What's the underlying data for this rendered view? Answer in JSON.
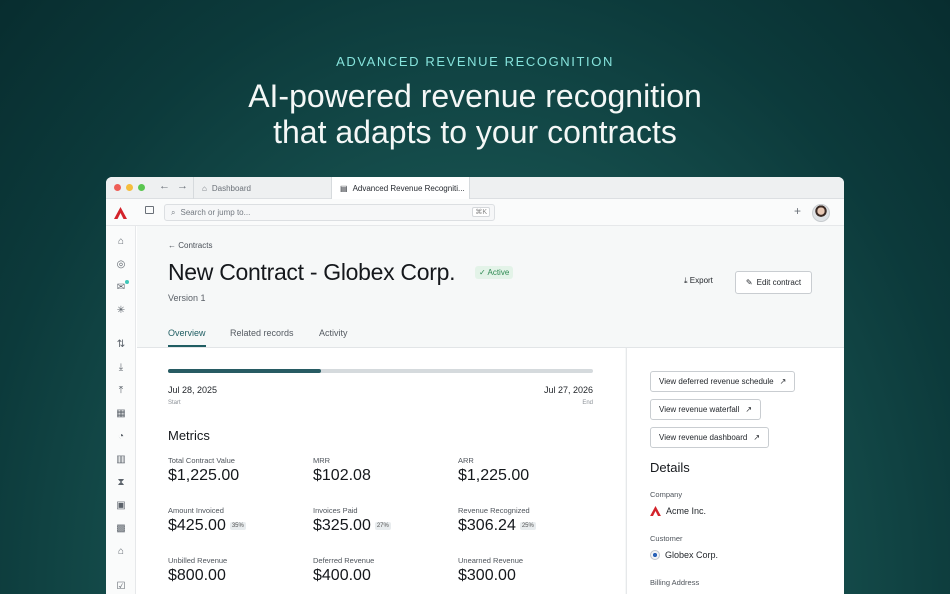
{
  "hero": {
    "eyebrow": "ADVANCED REVENUE RECOGNITION",
    "title_line1": "AI-powered revenue recognition",
    "title_line2": "that adapts to your contracts"
  },
  "browser": {
    "tabs": [
      {
        "label": "Dashboard",
        "icon": "home-icon"
      },
      {
        "label": "Advanced Revenue Recogniti...",
        "icon": "document-icon"
      }
    ]
  },
  "toolbar": {
    "search_placeholder": "Search or jump to...",
    "shortcut": "⌘K"
  },
  "sidebar": {
    "icons": [
      "home-icon",
      "revenue-icon",
      "inbox-icon",
      "sparkle-icon",
      "transfer-icon",
      "download-icon",
      "upload-icon",
      "grid-icon",
      "pie-chart-icon",
      "building-icon",
      "hourglass-icon",
      "calendar-icon",
      "calendar-check-icon",
      "bank-icon",
      "checklist-icon"
    ]
  },
  "page": {
    "breadcrumb": "Contracts",
    "title": "New Contract - Globex Corp.",
    "status": "Active",
    "version": "Version 1",
    "export_label": "Export",
    "edit_label": "Edit contract",
    "tabs": [
      "Overview",
      "Related records",
      "Activity"
    ]
  },
  "timeline": {
    "start_date": "Jul 28, 2025",
    "start_label": "Start",
    "end_date": "Jul 27, 2026",
    "end_label": "End",
    "progress_fraction": 0.36
  },
  "metrics": {
    "title": "Metrics",
    "items": [
      {
        "label": "Total Contract Value",
        "value": "$1,225.00",
        "pct": ""
      },
      {
        "label": "MRR",
        "value": "$102.08",
        "pct": ""
      },
      {
        "label": "ARR",
        "value": "$1,225.00",
        "pct": ""
      },
      {
        "label": "Amount Invoiced",
        "value": "$425.00",
        "pct": "35%"
      },
      {
        "label": "Invoices Paid",
        "value": "$325.00",
        "pct": "27%"
      },
      {
        "label": "Revenue Recognized",
        "value": "$306.24",
        "pct": "25%"
      },
      {
        "label": "Unbilled Revenue",
        "value": "$800.00",
        "pct": ""
      },
      {
        "label": "Deferred Revenue",
        "value": "$400.00",
        "pct": ""
      },
      {
        "label": "Unearned Revenue",
        "value": "$300.00",
        "pct": ""
      }
    ]
  },
  "links": [
    "View deferred revenue schedule",
    "View revenue waterfall",
    "View revenue dashboard"
  ],
  "details": {
    "title": "Details",
    "company_label": "Company",
    "company_value": "Acme Inc.",
    "customer_label": "Customer",
    "customer_value": "Globex Corp.",
    "billing_label": "Billing Address"
  },
  "colors": {
    "accent": "#1f5d62",
    "brand": "#d3232b",
    "active_green": "#2e8a52"
  }
}
